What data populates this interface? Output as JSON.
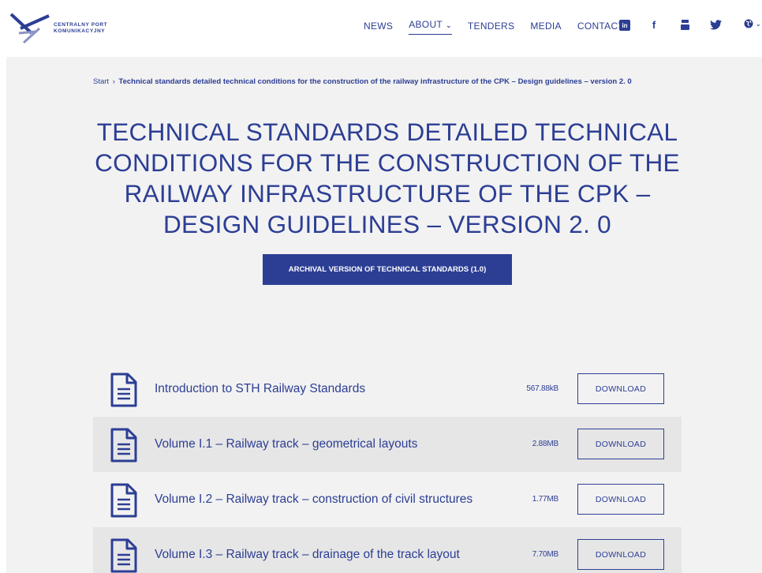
{
  "header": {
    "logo_line1": "CENTRALNY PORT",
    "logo_line2": "KOMUNIKACYJNY",
    "nav": [
      {
        "label": "NEWS"
      },
      {
        "label": "ABOUT"
      },
      {
        "label": "TENDERS"
      },
      {
        "label": "MEDIA"
      },
      {
        "label": "CONTACT"
      }
    ],
    "social_icons": [
      "linkedin-icon",
      "facebook-icon",
      "youtube-icon",
      "twitter-icon"
    ],
    "language_icon": "globe-icon"
  },
  "breadcrumb": {
    "start": "Start",
    "separator": "›",
    "current": "Technical standards detailed technical conditions for the construction of the railway infrastructure of the CPK – Design guidelines – version 2. 0"
  },
  "page": {
    "title": "TECHNICAL STANDARDS DETAILED TECHNICAL CONDITIONS FOR THE CONSTRUCTION OF THE RAILWAY INFRASTRUCTURE OF THE CPK – DESIGN GUIDELINES – VERSION 2. 0",
    "archive_button": "ARCHIVAL VERSION OF TECHNICAL STANDARDS (1.0)"
  },
  "documents": [
    {
      "title": "Introduction to STH Railway Standards",
      "size": "567.88kB",
      "button": "DOWNLOAD"
    },
    {
      "title": "Volume I.1 – Railway track – geometrical layouts",
      "size": "2.88MB",
      "button": "DOWNLOAD"
    },
    {
      "title": "Volume I.2 – Railway track – construction of civil structures",
      "size": "1.77MB",
      "button": "DOWNLOAD"
    },
    {
      "title": "Volume I.3 – Railway track – drainage of the track layout",
      "size": "7.70MB",
      "button": "DOWNLOAD"
    }
  ],
  "colors": {
    "brand": "#2c3e94",
    "page_bg": "#f2f2f2",
    "row_alt": "#e6e6e6"
  }
}
